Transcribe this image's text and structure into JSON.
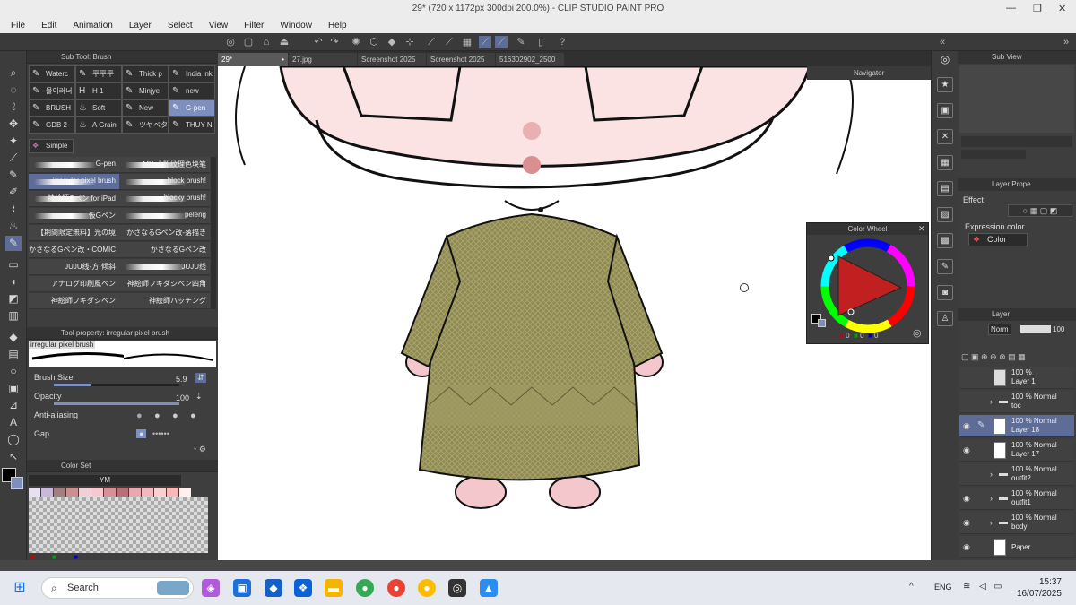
{
  "window": {
    "title": "29* (720 x 1172px 300dpi 200.0%) - CLIP STUDIO PAINT PRO"
  },
  "menu": [
    "File",
    "Edit",
    "Animation",
    "Layer",
    "Select",
    "View",
    "Filter",
    "Window",
    "Help"
  ],
  "subtool": {
    "title": "Sub Tool: Brush",
    "tabs": [
      "Waterc",
      "平平平",
      "Thick p",
      "India ink",
      "물이러너",
      "H 1",
      "Minjye",
      "new",
      "BRUSH",
      "Soft",
      "New",
      "G-pen",
      "GDB 2",
      "A Grain",
      "ツヤベタ",
      "THUY N"
    ],
    "selected_tab": "G-pen",
    "group": "Simple",
    "brushes": [
      "G-pen",
      "MX-水粉纹理色块笔",
      "irregular pixel brush",
      "block brush!",
      "神絵師Gペン for iPad",
      "blocky brush!",
      "仮Gペン",
      "peleng",
      "【期間限定無料】光の境",
      "かさなるGペン改-落描き",
      "かさなるGペン改・COMIC",
      "かさなるGペン改",
      "JUJU线-方·倾斜",
      "JUJU线",
      "アナログ印刷風ペン",
      "神絵師フキダシペン四角",
      "神絵師フキダシペン",
      "神絵師ハッチング"
    ],
    "selected_brush": "irregular pixel brush"
  },
  "toolprop": {
    "title": "Tool property: irregular pixel brush",
    "preview_label": "irregular pixel brush",
    "brush_size_label": "Brush Size",
    "brush_size": "5.9",
    "opacity_label": "Opacity",
    "opacity": "100",
    "antialiasing_label": "Anti-aliasing",
    "gap_label": "Gap"
  },
  "colorset": {
    "title": "Color Set",
    "set_name": "YM",
    "swatches": [
      "#e8e0f0",
      "#c9b8d8",
      "#a08080",
      "#c89090",
      "#f0d0d8",
      "#f8c8d0",
      "#d89098",
      "#b87078",
      "#e8a8b0",
      "#f0b8c0",
      "#f8d0d0",
      "#f8b8b8",
      "#fff0f0"
    ]
  },
  "tabs": [
    "29*",
    "27.jpg",
    "Screenshot 2025",
    "Screenshot 2025",
    "516302902_2500"
  ],
  "navigator": {
    "title": "Navigator"
  },
  "colorwheel": {
    "title": "Color Wheel",
    "r": "0",
    "g": "0",
    "b": "0"
  },
  "rightpanel": {
    "subview_title": "Sub View",
    "layerprop_title": "Layer Prope",
    "effect_label": "Effect",
    "expression_label": "Expression color",
    "expression_value": "Color",
    "layer_title": "Layer",
    "blend_mode": "Norm",
    "opacity": "100",
    "layers": [
      {
        "line1": "100 %",
        "line2": "Layer 1",
        "eye": false,
        "folder": false,
        "sel": false
      },
      {
        "line1": "100 % Normal",
        "line2": "toc",
        "eye": false,
        "folder": true,
        "sel": false
      },
      {
        "line1": "100 % Normal",
        "line2": "Layer 18",
        "eye": true,
        "folder": false,
        "sel": true
      },
      {
        "line1": "100 % Normal",
        "line2": "Layer 17",
        "eye": true,
        "folder": false,
        "sel": false
      },
      {
        "line1": "100 % Normal",
        "line2": "outfit2",
        "eye": false,
        "folder": true,
        "sel": false
      },
      {
        "line1": "100 % Normal",
        "line2": "outfit1",
        "eye": true,
        "folder": true,
        "sel": false
      },
      {
        "line1": "100 % Normal",
        "line2": "body",
        "eye": true,
        "folder": true,
        "sel": false
      },
      {
        "line1": "",
        "line2": "Paper",
        "eye": true,
        "folder": false,
        "sel": false
      }
    ]
  },
  "taskbar": {
    "search": "Search",
    "lang": "ENG",
    "time": "15:37",
    "date": "16/07/2025"
  },
  "colors": {
    "accent": "#7c8fbf",
    "dress": "#8f8a55",
    "skin": "#fbe3e3"
  }
}
